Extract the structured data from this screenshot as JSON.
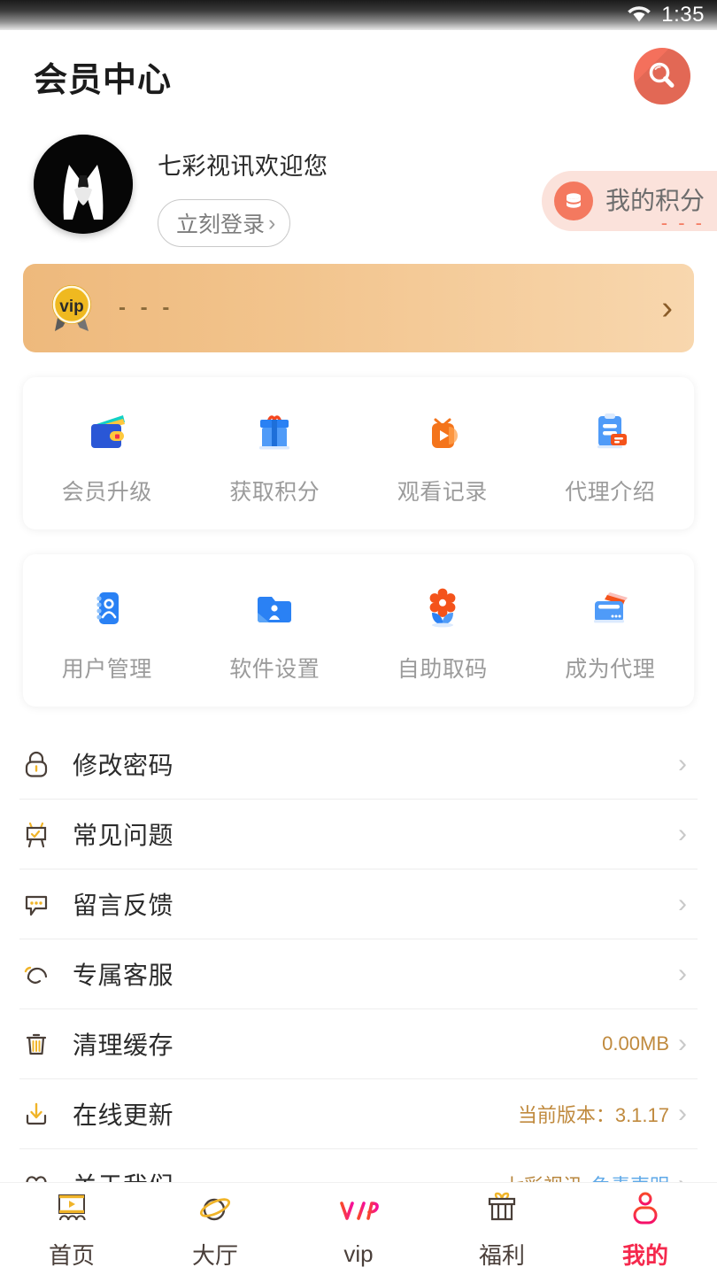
{
  "statusbar": {
    "time": "1:35",
    "wifi_icon": "wifi-icon"
  },
  "appbar": {
    "title": "会员中心",
    "search_icon": "search-icon"
  },
  "profile": {
    "avatar_icon": "avatar-suit-icon",
    "welcome": "七彩视讯欢迎您",
    "login_label": "立刻登录",
    "login_chevron": "›",
    "points": {
      "icon": "coins-icon",
      "label": "我的积分",
      "value": "- - -"
    }
  },
  "vip_banner": {
    "badge_text": "vip",
    "value": "- - -",
    "chevron": "›"
  },
  "grids": [
    {
      "items": [
        {
          "icon": "wallet-icon",
          "label": "会员升级"
        },
        {
          "icon": "gift-icon",
          "label": "获取积分"
        },
        {
          "icon": "tv-play-icon",
          "label": "观看记录"
        },
        {
          "icon": "clipboard-icon",
          "label": "代理介绍"
        }
      ]
    },
    {
      "items": [
        {
          "icon": "contact-book-icon",
          "label": "用户管理"
        },
        {
          "icon": "user-folder-icon",
          "label": "软件设置"
        },
        {
          "icon": "flower-icon",
          "label": "自助取码"
        },
        {
          "icon": "card-envelope-icon",
          "label": "成为代理"
        }
      ]
    }
  ],
  "list": [
    {
      "icon": "lock-icon",
      "label": "修改密码",
      "value": "",
      "value2": "",
      "chevron": "›"
    },
    {
      "icon": "easel-icon",
      "label": "常见问题",
      "value": "",
      "value2": "",
      "chevron": "›"
    },
    {
      "icon": "comment-icon",
      "label": "留言反馈",
      "value": "",
      "value2": "",
      "chevron": "›"
    },
    {
      "icon": "headset-icon",
      "label": "专属客服",
      "value": "",
      "value2": "",
      "chevron": "›"
    },
    {
      "icon": "trash-icon",
      "label": "清理缓存",
      "value": "0.00MB",
      "value2": "",
      "chevron": "›"
    },
    {
      "icon": "download-icon",
      "label": "在线更新",
      "value": "当前版本：3.1.17",
      "value2": "",
      "chevron": "›"
    },
    {
      "icon": "heart-icon",
      "label": "关于我们",
      "value": "七彩视讯",
      "value2": "免责声明",
      "chevron": "›"
    }
  ],
  "bottomnav": [
    {
      "icon": "home-video-icon",
      "label": "首页",
      "active": false
    },
    {
      "icon": "planet-icon",
      "label": "大厅",
      "active": false
    },
    {
      "icon": "vip-icon",
      "label": "vip",
      "active": false
    },
    {
      "icon": "gift-box-icon",
      "label": "福利",
      "active": false
    },
    {
      "icon": "person-icon",
      "label": "我的",
      "active": true
    }
  ],
  "colors": {
    "accent_red": "#f5294d",
    "search_red": "#f4705c",
    "vip_gold": "#efb920",
    "banner_from": "#eeb97c",
    "banner_to": "#f8d7ae",
    "pill_bg": "#fbe2db",
    "brand_gold": "#b8873f",
    "link_blue": "#5fa9e8"
  }
}
